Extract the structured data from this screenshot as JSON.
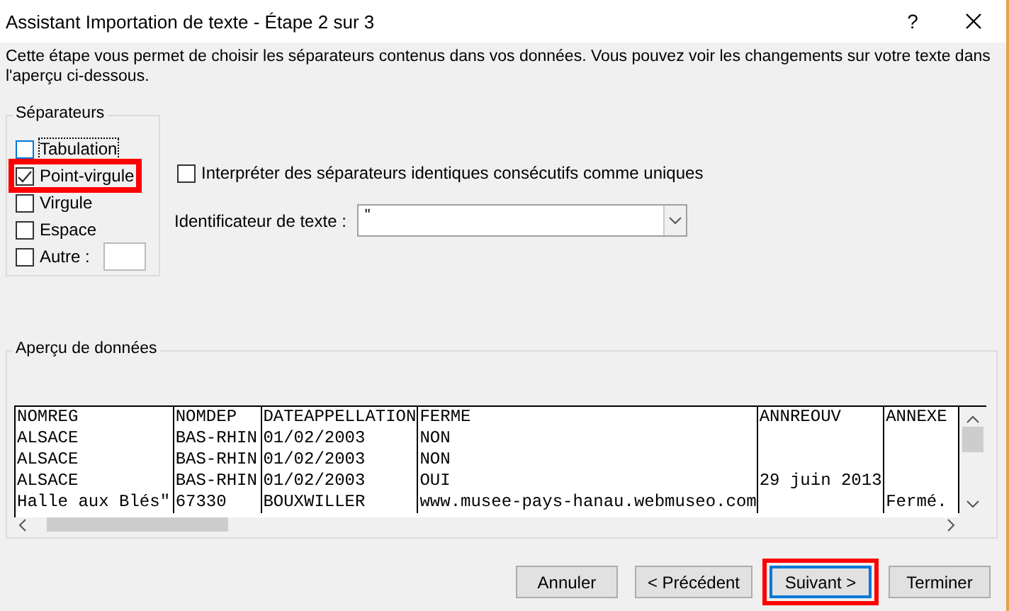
{
  "window": {
    "title": "Assistant Importation de texte - Étape 2 sur 3",
    "help": "?"
  },
  "description": "Cette étape vous permet de choisir les séparateurs contenus dans vos données. Vous pouvez voir les changements sur votre texte dans l'aperçu ci-dessous.",
  "separators": {
    "title": "Séparateurs",
    "items": [
      {
        "label": "Tabulation",
        "checked": false,
        "focused": true,
        "highlighted": false
      },
      {
        "label": "Point-virgule",
        "checked": true,
        "focused": false,
        "highlighted": true
      },
      {
        "label": "Virgule",
        "checked": false,
        "focused": false,
        "highlighted": false
      },
      {
        "label": "Espace",
        "checked": false,
        "focused": false,
        "highlighted": false
      },
      {
        "label": "Autre :",
        "checked": false,
        "focused": false,
        "highlighted": false,
        "kind": "other"
      }
    ]
  },
  "consecutive": {
    "label": "Interpréter des séparateurs identiques consécutifs comme uniques",
    "checked": false
  },
  "text_qualifier": {
    "label": "Identificateur de texte :",
    "value": "\""
  },
  "preview": {
    "title": "Aperçu de données",
    "rows": [
      [
        "NOMREG",
        "NOMDEP",
        "DATEAPPELLATION",
        "FERME",
        "ANNREOUV",
        "ANNEXE"
      ],
      [
        "ALSACE",
        "BAS-RHIN",
        "01/02/2003",
        "NON",
        "",
        ""
      ],
      [
        "ALSACE",
        "BAS-RHIN",
        "01/02/2003",
        "NON",
        "",
        ""
      ],
      [
        "ALSACE",
        "BAS-RHIN",
        "01/02/2003",
        "OUI",
        "29 juin 2013",
        ""
      ],
      [
        "Halle aux Blés\"",
        "67330",
        "BOUXWILLER",
        "www.musee-pays-hanau.webmuseo.com",
        "",
        "Fermé."
      ]
    ]
  },
  "buttons": [
    {
      "label": "Annuler",
      "default": false,
      "highlighted": false
    },
    {
      "label": "< Précédent",
      "default": false,
      "highlighted": false
    },
    {
      "label": "Suivant >",
      "default": true,
      "highlighted": true
    },
    {
      "label": "Terminer",
      "default": false,
      "highlighted": false
    }
  ]
}
